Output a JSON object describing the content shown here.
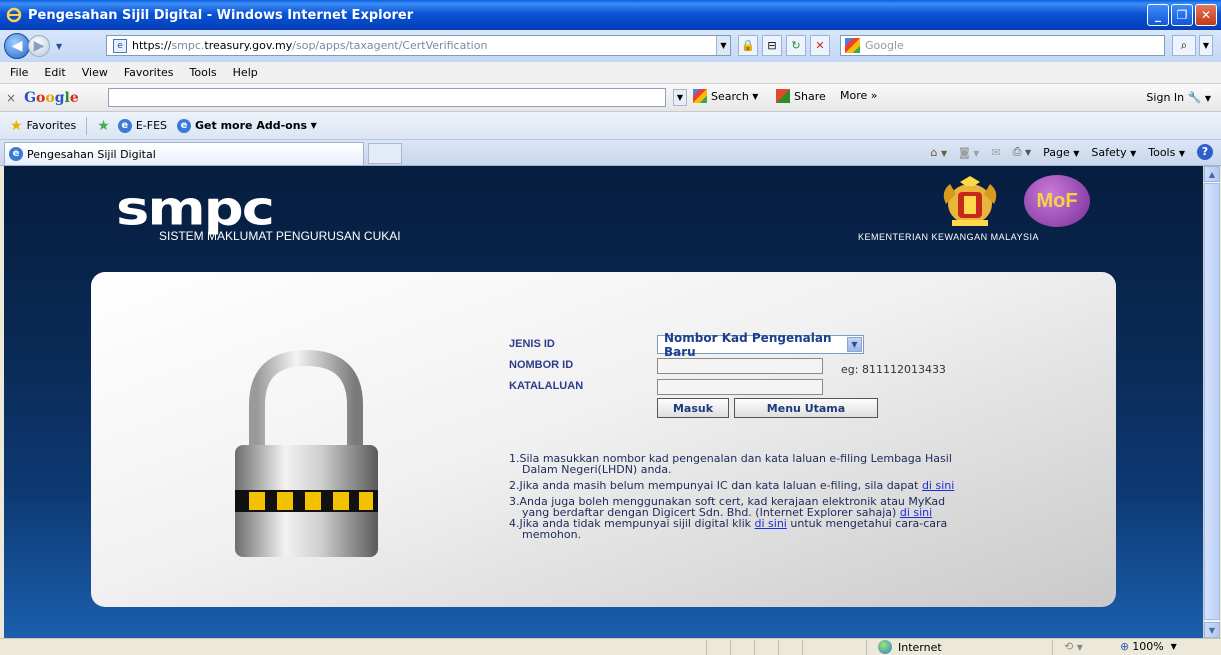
{
  "window": {
    "title": "Pengesahan Sijil Digital - Windows Internet Explorer"
  },
  "address": {
    "url_prefix": "https://",
    "url_domain_dim": "smpc.",
    "url_domain": "treasury.gov.my",
    "url_path": "/sop/apps/taxagent/CertVerification",
    "search_placeholder": "Google"
  },
  "menu": [
    "File",
    "Edit",
    "View",
    "Favorites",
    "Tools",
    "Help"
  ],
  "google_toolbar": {
    "close": "×",
    "logo": [
      "G",
      "o",
      "o",
      "g",
      "l",
      "e"
    ],
    "search": "Search",
    "share": "Share",
    "more": "More »",
    "sign_in": "Sign In"
  },
  "favorites_bar": {
    "favorites": "Favorites",
    "items": [
      "E-FES",
      "Get more Add-ons"
    ]
  },
  "tabs": {
    "active": "Pengesahan Sijil Digital"
  },
  "command_bar": {
    "page": "Page",
    "safety": "Safety",
    "tools": "Tools"
  },
  "page": {
    "brand": "smpc",
    "brand_sub": "SISTEM MAKLUMAT PENGURUSAN CUKAI",
    "mof_logo": "MoF",
    "ministry": "KEMENTERIAN KEWANGAN MALAYSIA",
    "form": {
      "jenis_id_label": "JENIS ID",
      "jenis_id_value": "Nombor Kad Pengenalan Baru",
      "nombor_id_label": "NOMBOR ID",
      "nombor_id_example": "eg: 811112013433",
      "katalaluan_label": "KATALALUAN",
      "masuk": "Masuk",
      "menu_utama": "Menu Utama"
    },
    "notes": {
      "n1_a": "1.Sila masukkan nombor kad pengenalan dan kata laluan e-filing Lembaga Hasil",
      "n1_b": "Dalam Negeri(LHDN) anda.",
      "n2": "2.Jika anda masih belum mempunyai IC dan kata laluan e-filing, sila dapat ",
      "n3_a": "3.Anda juga boleh menggunakan soft cert, kad kerajaan elektronik atau MyKad",
      "n3_b": "yang berdaftar dengan Digicert Sdn. Bhd. (Internet Explorer sahaja) ",
      "n4_a": "4.Jika anda tidak mempunyai sijil digital klik ",
      "n4_b": " untuk mengetahui cara-cara",
      "n4_c": "memohon.",
      "link": "di sini"
    }
  },
  "status": {
    "zone": "Internet",
    "zoom": "100%"
  }
}
